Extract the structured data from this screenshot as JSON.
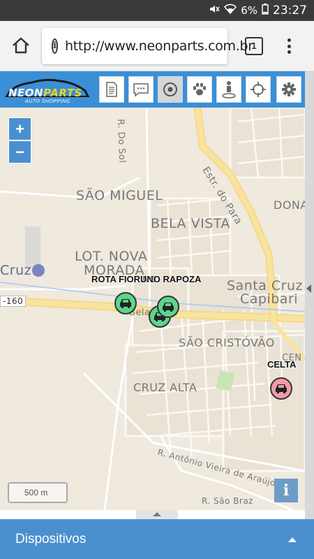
{
  "status_bar": {
    "battery": "6%",
    "time": "23:27"
  },
  "browser": {
    "url": "http://www.neonparts.com.br",
    "tab_count": "1"
  },
  "app": {
    "logo_neon": "NEON",
    "logo_parts": "PARTS",
    "logo_sub": "AUTO SHOPPING",
    "tools": [
      "document-icon",
      "chat-icon",
      "target-icon",
      "paw-icon",
      "person-pin-icon",
      "crosshair-icon",
      "gear-icon"
    ]
  },
  "map": {
    "zoom_in": "+",
    "zoom_out": "−",
    "scale": "500 m",
    "info": "i",
    "labels": {
      "sao_miguel": "SÃO MIGUEL",
      "bela_vista": "BELA VISTA",
      "lot_nova": "LOT. NOVA",
      "morada": "MORADA",
      "cruz": "Cruz",
      "br160": "-160",
      "santa_cruz": "Santa Cruz",
      "capibari": "Capibari",
      "sao_cristovao": "SÃO CRISTÓVÃO",
      "cruz_alta": "CRUZ ALTA",
      "dona": "DONA",
      "rua_do_sol": "R. Do Sol",
      "estr_do_para": "Estr. do Para",
      "antonio_vieira": "R. Antônio Vieira de Araújo",
      "sao_braz": "R. São Braz",
      "bela_vista_road": "Bela Vista",
      "cen": "CEN"
    },
    "vehicles": [
      {
        "name": "ROTA FIORINO",
        "status": "green"
      },
      {
        "name": "UNO RAPOZA",
        "status": "green"
      },
      {
        "name": "CELTA",
        "status": "pink"
      }
    ]
  },
  "bottom": {
    "title": "Dispositivos"
  }
}
